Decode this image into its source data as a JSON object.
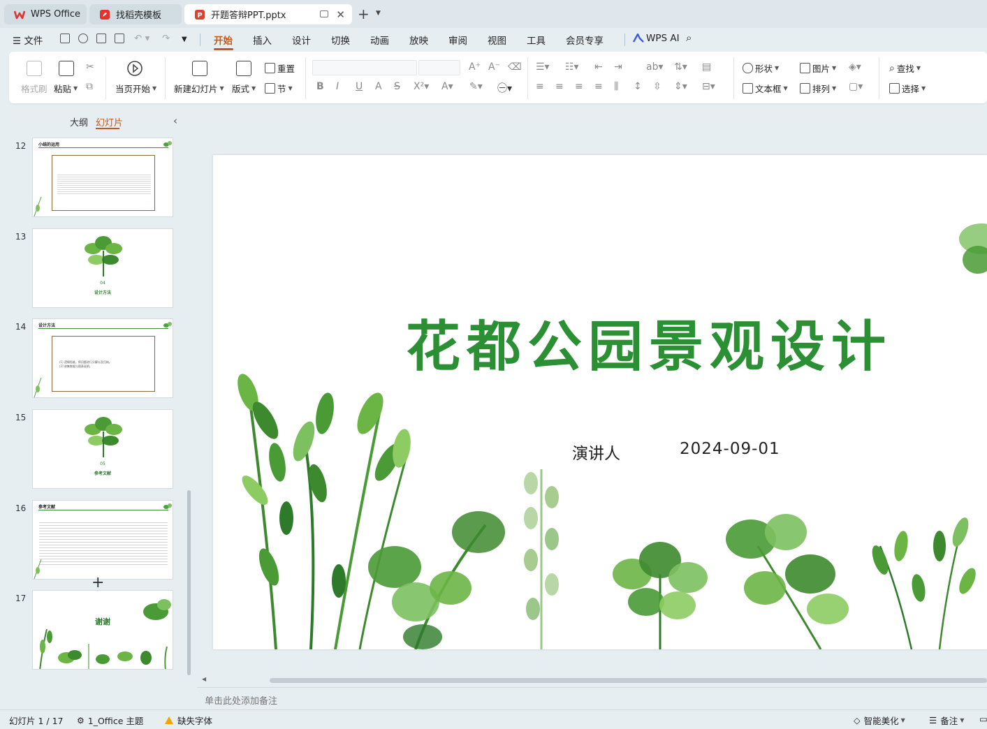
{
  "colors": {
    "accent": "#c45a1a",
    "title_green": "#2b8f33",
    "wps_red": "#e0342c"
  },
  "tabs": [
    {
      "label": "WPS Office",
      "icon": "wps-logo-icon"
    },
    {
      "label": "找稻壳模板",
      "icon": "docer-icon"
    },
    {
      "label": "开题答辩PPT.pptx",
      "icon": "presentation-file-icon"
    }
  ],
  "menu": {
    "file": "文件",
    "items": [
      "开始",
      "插入",
      "设计",
      "切换",
      "动画",
      "放映",
      "审阅",
      "视图",
      "工具",
      "会员专享"
    ],
    "active": "开始",
    "ai": "WPS AI"
  },
  "ribbon": {
    "format_painter": "格式刷",
    "paste": "粘贴",
    "start_from_current": "当页开始",
    "new_slide": "新建幻灯片",
    "layout": "版式",
    "section": "节",
    "reset": "重置",
    "shape": "形状",
    "picture": "图片",
    "textbox": "文本框",
    "arrange": "排列",
    "find": "查找",
    "select": "选择"
  },
  "panel": {
    "tab_outline": "大纲",
    "tab_slides": "幻灯片",
    "thumbs": [
      {
        "num": "12",
        "title": "小结的运用"
      },
      {
        "num": "13",
        "section_num": "04",
        "section_title": "设计方法"
      },
      {
        "num": "14",
        "title": "设计方法",
        "lines": [
          "(1) 逻辑思维，将问题进行分解以及归纳。",
          "(2) 收集数据与图表说明。"
        ]
      },
      {
        "num": "15",
        "section_num": "05",
        "section_title": "参考文献"
      },
      {
        "num": "16",
        "title": "参考文献"
      },
      {
        "num": "17",
        "thanks": "谢谢"
      }
    ]
  },
  "slide": {
    "title": "花都公园景观设计",
    "presenter": "演讲人",
    "date": "2024-09-01"
  },
  "notes_placeholder": "单击此处添加备注",
  "status": {
    "slide_counter": "幻灯片 1 / 17",
    "theme": "1_Office 主题",
    "missing_fonts": "缺失字体",
    "smart_beautify": "智能美化",
    "notes": "备注"
  }
}
